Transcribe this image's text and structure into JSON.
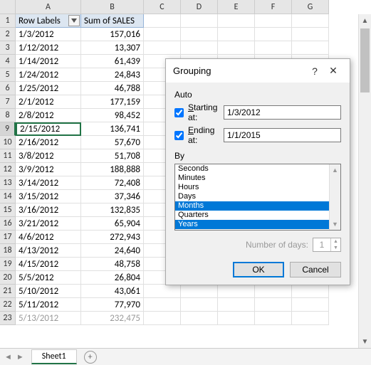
{
  "columns": [
    "A",
    "B",
    "C",
    "D",
    "E",
    "F",
    "G"
  ],
  "header_row": {
    "A": "Row Labels",
    "B": "Sum of SALES"
  },
  "active_cell": "A9",
  "rows": [
    {
      "n": 2,
      "A": "1/3/2012",
      "B": "157,016"
    },
    {
      "n": 3,
      "A": "1/12/2012",
      "B": "13,307"
    },
    {
      "n": 4,
      "A": "1/14/2012",
      "B": "61,439"
    },
    {
      "n": 5,
      "A": "1/24/2012",
      "B": "24,843"
    },
    {
      "n": 6,
      "A": "1/25/2012",
      "B": "46,788"
    },
    {
      "n": 7,
      "A": "2/1/2012",
      "B": "177,159"
    },
    {
      "n": 8,
      "A": "2/8/2012",
      "B": "98,452"
    },
    {
      "n": 9,
      "A": "2/15/2012",
      "B": "136,741"
    },
    {
      "n": 10,
      "A": "2/16/2012",
      "B": "57,670"
    },
    {
      "n": 11,
      "A": "3/8/2012",
      "B": "51,708"
    },
    {
      "n": 12,
      "A": "3/9/2012",
      "B": "188,888"
    },
    {
      "n": 13,
      "A": "3/14/2012",
      "B": "72,408"
    },
    {
      "n": 14,
      "A": "3/15/2012",
      "B": "37,346"
    },
    {
      "n": 15,
      "A": "3/16/2012",
      "B": "132,835"
    },
    {
      "n": 16,
      "A": "3/21/2012",
      "B": "65,904"
    },
    {
      "n": 17,
      "A": "4/6/2012",
      "B": "272,943"
    },
    {
      "n": 18,
      "A": "4/13/2012",
      "B": "24,640"
    },
    {
      "n": 19,
      "A": "4/15/2012",
      "B": "48,758"
    },
    {
      "n": 20,
      "A": "5/5/2012",
      "B": "26,804"
    },
    {
      "n": 21,
      "A": "5/10/2012",
      "B": "43,061"
    },
    {
      "n": 22,
      "A": "5/11/2012",
      "B": "77,970"
    },
    {
      "n": 23,
      "A": "5/13/2012",
      "B": "232,475"
    }
  ],
  "dialog": {
    "title": "Grouping",
    "auto_label": "Auto",
    "starting_label": "Starting at:",
    "ending_label": "Ending at:",
    "starting_checked": true,
    "ending_checked": true,
    "starting_value": "1/3/2012",
    "ending_value": "1/1/2015",
    "by_label": "By",
    "items": [
      {
        "label": "Seconds",
        "sel": false
      },
      {
        "label": "Minutes",
        "sel": false
      },
      {
        "label": "Hours",
        "sel": false
      },
      {
        "label": "Days",
        "sel": false
      },
      {
        "label": "Months",
        "sel": true
      },
      {
        "label": "Quarters",
        "sel": false
      },
      {
        "label": "Years",
        "sel": true
      }
    ],
    "numdays_label": "Number of days:",
    "numdays_value": "1",
    "ok": "OK",
    "cancel": "Cancel"
  },
  "sheet": {
    "name": "Sheet1"
  }
}
